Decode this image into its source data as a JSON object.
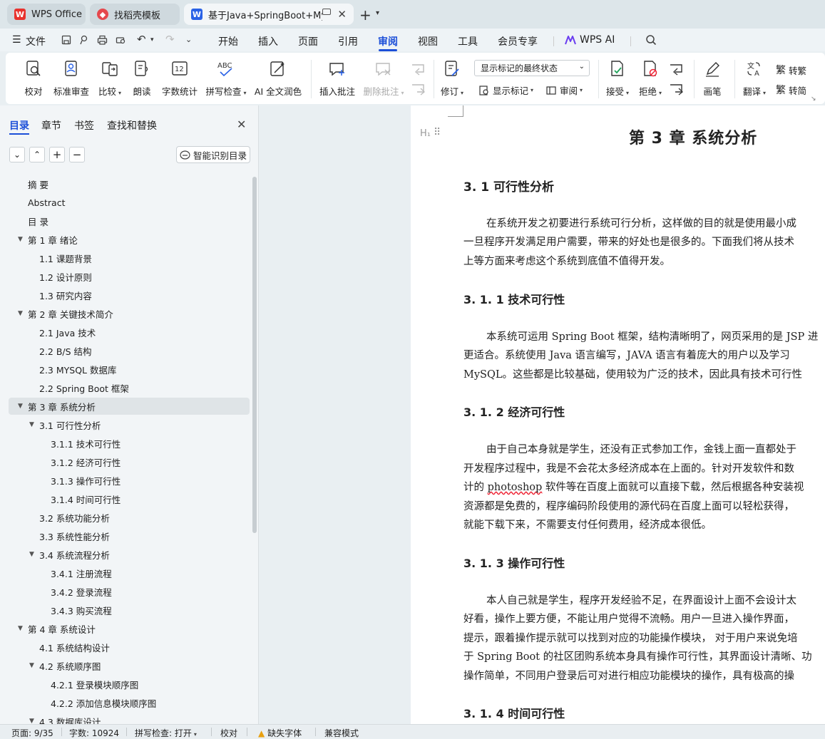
{
  "tabs": [
    {
      "label": "WPS Office",
      "icon": "wps-logo-icon"
    },
    {
      "label": "找稻壳模板",
      "icon": "docer-icon"
    },
    {
      "label": "基于Java+SpringBoot+MyS",
      "icon": "word-doc-icon"
    }
  ],
  "menu": {
    "file": "文件",
    "items": [
      "开始",
      "插入",
      "页面",
      "引用",
      "审阅",
      "视图",
      "工具",
      "会员专享"
    ],
    "active": "审阅",
    "ai": "WPS AI"
  },
  "ribbon": {
    "proofread": "校对",
    "standard_review": "标准审查",
    "compare": "比较",
    "read_aloud": "朗读",
    "word_count": "字数统计",
    "spell_check": "拼写检查",
    "ai_polish": "AI 全文润色",
    "insert_comment": "插入批注",
    "delete_comment": "删除批注",
    "track_changes": "修订",
    "markup_select": "显示标记的最终状态",
    "show_markup": "显示标记",
    "review_pane": "审阅",
    "accept": "接受",
    "reject": "拒绝",
    "pen": "画笔",
    "translate": "翻译",
    "to_traditional": "转繁",
    "to_simplified": "转简"
  },
  "panel": {
    "tabs": [
      "目录",
      "章节",
      "书签",
      "查找和替换"
    ],
    "active_tab": "目录",
    "smart_toc": "智能识别目录",
    "toc": [
      {
        "label": "摘  要",
        "level": 1,
        "arrow": false
      },
      {
        "label": "Abstract",
        "level": 1,
        "arrow": false
      },
      {
        "label": "目  录",
        "level": 1,
        "arrow": false
      },
      {
        "label": "第 1 章  绪论",
        "level": 1,
        "arrow": true
      },
      {
        "label": "1.1  课题背景",
        "level": 2,
        "arrow": false
      },
      {
        "label": "1.2    设计原则",
        "level": 2,
        "arrow": false
      },
      {
        "label": "1.3    研究内容",
        "level": 2,
        "arrow": false
      },
      {
        "label": "第 2 章    关键技术简介",
        "level": 1,
        "arrow": true
      },
      {
        "label": "2.1 Java 技术",
        "level": 2,
        "arrow": false
      },
      {
        "label": "2.2 B/S 结构",
        "level": 2,
        "arrow": false
      },
      {
        "label": "2.3 MYSQL 数据库",
        "level": 2,
        "arrow": false
      },
      {
        "label": "2.2 Spring Boot 框架",
        "level": 2,
        "arrow": false
      },
      {
        "label": "第 3 章  系统分析",
        "level": 1,
        "arrow": true,
        "selected": true
      },
      {
        "label": "3.1  可行性分析",
        "level": 2,
        "arrow": true
      },
      {
        "label": "3.1.1  技术可行性",
        "level": 3,
        "arrow": false
      },
      {
        "label": "3.1.2  经济可行性",
        "level": 3,
        "arrow": false
      },
      {
        "label": "3.1.3  操作可行性",
        "level": 3,
        "arrow": false
      },
      {
        "label": "3.1.4  时间可行性",
        "level": 3,
        "arrow": false
      },
      {
        "label": "3.2  系统功能分析",
        "level": 2,
        "arrow": false
      },
      {
        "label": "3.3  系统性能分析",
        "level": 2,
        "arrow": false
      },
      {
        "label": "3.4  系统流程分析",
        "level": 2,
        "arrow": true
      },
      {
        "label": "3.4.1 注册流程",
        "level": 3,
        "arrow": false
      },
      {
        "label": "3.4.2 登录流程",
        "level": 3,
        "arrow": false
      },
      {
        "label": "3.4.3 购买流程",
        "level": 3,
        "arrow": false
      },
      {
        "label": "第 4 章    系统设计",
        "level": 1,
        "arrow": true
      },
      {
        "label": "4.1  系统结构设计",
        "level": 2,
        "arrow": false
      },
      {
        "label": "4.2 系统顺序图",
        "level": 2,
        "arrow": true
      },
      {
        "label": "4.2.1 登录模块顺序图",
        "level": 3,
        "arrow": false
      },
      {
        "label": "4.2.2 添加信息模块顺序图",
        "level": 3,
        "arrow": false
      },
      {
        "label": "4.3  数据库设计",
        "level": 2,
        "arrow": true
      }
    ]
  },
  "doc": {
    "chapter_title": "第 3 章  系统分析",
    "h_3_1": "3. 1  可行性分析",
    "p_3_1": [
      "在系统开发之初要进行系统可行分析，这样做的目的就是使用最小成",
      "一旦程序开发满足用户需要，带来的好处也是很多的。下面我们将从技术",
      "上等方面来考虑这个系统到底值不值得开发。"
    ],
    "h_3_1_1": "3. 1. 1  技术可行性",
    "p_3_1_1": [
      "本系统可运用 Spring Boot 框架，结构清晰明了，网页采用的是 JSP 进",
      "更适合。系统使用 Java 语言编写，JAVA 语言有着庞大的用户以及学习",
      "MySQL。这些都是比较基础，使用较为广泛的技术，因此具有技术可行性"
    ],
    "h_3_1_2": "3. 1. 2  经济可行性",
    "p_3_1_2": [
      "由于自己本身就是学生，还没有正式参加工作，金钱上面一直都处于",
      "开发程序过程中，我是不会花太多经济成本在上面的。针对开发软件和数",
      "计的",
      "photoshop",
      " 软件等在百度上面就可以直接下载，然后根据各种安装视",
      "资源都是免费的，程序编码阶段使用的源代码在百度上面可以轻松获得，",
      "就能下载下来，不需要支付任何费用，经济成本很低。"
    ],
    "h_3_1_3": "3. 1. 3  操作可行性",
    "p_3_1_3": [
      "本人自己就是学生，程序开发经验不足，在界面设计上面不会设计太",
      "好看，操作上要方便，不能让用户觉得不流畅。用户一旦进入操作界面，",
      "提示，跟着操作提示就可以找到对应的功能操作模块， 对于用户来说免培",
      "于 Spring Boot 的社区团购系统本身具有操作可行性，其界面设计清晰、功",
      "操作简单，不同用户登录后可对进行相应功能模块的操作，具有极高的操"
    ],
    "h_3_1_4": "3. 1. 4  时间可行性"
  },
  "status": {
    "page": "页面: 9/35",
    "words": "字数: 10924",
    "spell": "拼写检查: 打开",
    "proof": "校对",
    "missing_font": "缺失字体",
    "compat": "兼容模式"
  }
}
